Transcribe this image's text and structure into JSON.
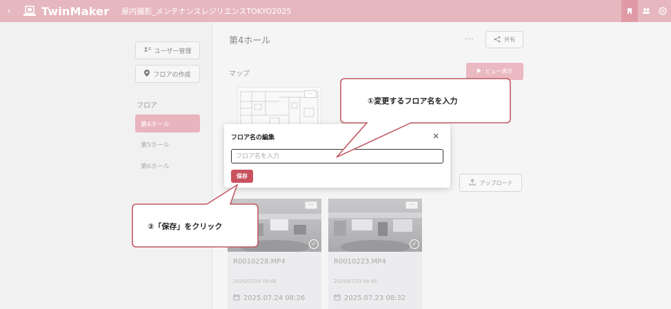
{
  "header": {
    "back_glyph": "‹",
    "brand": "TwinMaker",
    "project": "屋内撮影_メンテナンスレジリエンスTOKYO2025",
    "icons": [
      "building-icon",
      "users-icon",
      "globe-icon"
    ]
  },
  "sidebar": {
    "user_mgmt_label": "ユーザー管理",
    "create_floor_label": "フロアの作成",
    "floor_heading": "フロア",
    "floors": [
      {
        "label": "第4ホール",
        "active": true
      },
      {
        "label": "第5ホール",
        "active": false
      },
      {
        "label": "第6ホール",
        "active": false
      }
    ]
  },
  "main": {
    "title": "第4ホール",
    "more_glyph": "···",
    "share_label": "共有",
    "map_label": "マップ",
    "view_label": "ビュー表示",
    "upload_label": "アップロード",
    "cards": [
      {
        "name": "R0010228.MP4",
        "date_small": "2025/07/24 09:48",
        "date": "2025.07.24 08:26"
      },
      {
        "name": "R0010223.MP4",
        "date_small": "2025/07/23 08:45",
        "date": "2025.07.23 08:32"
      }
    ]
  },
  "dialog": {
    "title": "フロア名の編集",
    "close_glyph": "×",
    "input_value": "",
    "input_placeholder": "フロア名を入力",
    "save_label": "保存"
  },
  "callouts": {
    "step1": "①変更するフロア名を入力",
    "step2": "②「保存」をクリック"
  },
  "colors": {
    "header": "#e6b7bf",
    "accent": "#c9525f",
    "active_floor": "#e8b4bd",
    "callout_border": "#c05a64"
  }
}
